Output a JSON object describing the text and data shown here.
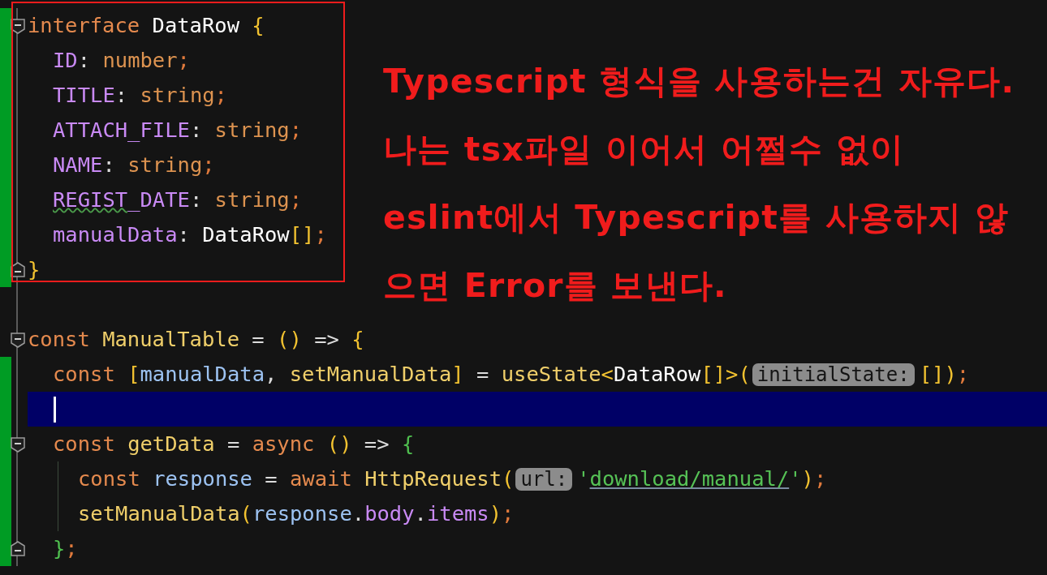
{
  "editor": {
    "lines": [
      {
        "changed": true,
        "current": false,
        "fold_end": false,
        "tokens": [
          {
            "kind": "kw",
            "text": "interface "
          },
          {
            "kind": "cls",
            "text": "DataRow "
          },
          {
            "kind": "br1",
            "text": "{"
          }
        ],
        "children": [
          {
            "changed": true,
            "current": false,
            "fold_end": false,
            "tokens": [
              {
                "kind": "prop",
                "text": "ID"
              },
              {
                "kind": "op",
                "text": ": "
              },
              {
                "kind": "type",
                "text": "number"
              },
              {
                "kind": "punct",
                "text": ";"
              }
            ]
          },
          {
            "changed": true,
            "current": false,
            "fold_end": false,
            "tokens": [
              {
                "kind": "prop",
                "text": "TITLE"
              },
              {
                "kind": "op",
                "text": ": "
              },
              {
                "kind": "type",
                "text": "string"
              },
              {
                "kind": "punct",
                "text": ";"
              }
            ]
          },
          {
            "changed": true,
            "current": false,
            "fold_end": false,
            "tokens": [
              {
                "kind": "prop",
                "text": "ATTACH_FILE"
              },
              {
                "kind": "op",
                "text": ": "
              },
              {
                "kind": "type",
                "text": "string"
              },
              {
                "kind": "punct",
                "text": ";"
              }
            ]
          },
          {
            "changed": true,
            "current": false,
            "fold_end": false,
            "tokens": [
              {
                "kind": "prop",
                "text": "NAME"
              },
              {
                "kind": "op",
                "text": ": "
              },
              {
                "kind": "type",
                "text": "string"
              },
              {
                "kind": "punct",
                "text": ";"
              }
            ]
          },
          {
            "changed": true,
            "current": false,
            "fold_end": false,
            "tokens": [
              {
                "kind": "prop",
                "text": "REGIST",
                "warning": true
              },
              {
                "kind": "prop",
                "text": "_DATE",
                "warning": false
              },
              {
                "kind": "op",
                "text": ": "
              },
              {
                "kind": "type",
                "text": "string"
              },
              {
                "kind": "punct",
                "text": ";"
              }
            ]
          },
          {
            "changed": true,
            "current": false,
            "fold_end": false,
            "tokens": [
              {
                "kind": "prop",
                "text": "manualData"
              },
              {
                "kind": "op",
                "text": ": "
              },
              {
                "kind": "cls",
                "text": "DataRow"
              },
              {
                "kind": "br1",
                "text": "[]"
              },
              {
                "kind": "punct",
                "text": ";"
              }
            ]
          }
        ]
      },
      {
        "changed": true,
        "current": false,
        "fold_end": true,
        "tokens": [
          {
            "kind": "br1",
            "text": "}"
          }
        ]
      },
      {
        "changed": false,
        "current": false,
        "fold_end": false
      },
      {
        "changed": false,
        "current": false,
        "fold_end": false,
        "tokens": [
          {
            "kind": "kw",
            "text": "const "
          },
          {
            "kind": "fn",
            "text": "ManualTable"
          },
          {
            "kind": "op",
            "text": " = "
          },
          {
            "kind": "br1",
            "text": "()"
          },
          {
            "kind": "op",
            "text": " => "
          },
          {
            "kind": "br1",
            "text": "{"
          }
        ],
        "children": [
          {
            "changed": true,
            "current": false,
            "fold_end": false,
            "tokens": [
              {
                "kind": "kw",
                "text": "const "
              },
              {
                "kind": "br1",
                "text": "["
              },
              {
                "kind": "var",
                "text": "manualData"
              },
              {
                "kind": "op",
                "text": ", "
              },
              {
                "kind": "fn",
                "text": "setManualData"
              },
              {
                "kind": "br1",
                "text": "]"
              },
              {
                "kind": "op",
                "text": " = "
              },
              {
                "kind": "fn",
                "text": "useState"
              },
              {
                "kind": "br1",
                "text": "<"
              },
              {
                "kind": "cls",
                "text": "DataRow"
              },
              {
                "kind": "br1",
                "text": "[]>("
              }
            ],
            "hint": "initialState:",
            "after": [
              {
                "kind": "br1",
                "text": "[])"
              },
              {
                "kind": "punct",
                "text": ";"
              }
            ]
          },
          {
            "changed": true,
            "current": true,
            "fold_end": false
          },
          {
            "changed": true,
            "current": false,
            "fold_end": false,
            "tokens": [
              {
                "kind": "kw",
                "text": "const "
              },
              {
                "kind": "fn",
                "text": "getData"
              },
              {
                "kind": "op",
                "text": " = "
              },
              {
                "kind": "kw",
                "text": "async "
              },
              {
                "kind": "br1",
                "text": "()"
              },
              {
                "kind": "op",
                "text": " => "
              },
              {
                "kind": "br2",
                "text": "{"
              }
            ],
            "children": [
              {
                "changed": true,
                "current": false,
                "fold_end": false,
                "tokens": [
                  {
                    "kind": "kw",
                    "text": "const "
                  },
                  {
                    "kind": "var",
                    "text": "response"
                  },
                  {
                    "kind": "op",
                    "text": " = "
                  },
                  {
                    "kind": "kw",
                    "text": "await "
                  },
                  {
                    "kind": "fn",
                    "text": "HttpRequest"
                  },
                  {
                    "kind": "br1",
                    "text": "("
                  }
                ],
                "hint": "url:",
                "after": [
                  {
                    "kind": "str",
                    "text": "'"
                  },
                  {
                    "kind": "link",
                    "text": "download/manual/"
                  },
                  {
                    "kind": "str",
                    "text": "'"
                  },
                  {
                    "kind": "br1",
                    "text": ")"
                  },
                  {
                    "kind": "punct",
                    "text": ";"
                  }
                ]
              },
              {
                "changed": true,
                "current": false,
                "fold_end": false,
                "tokens": [
                  {
                    "kind": "fn",
                    "text": "setManualData"
                  },
                  {
                    "kind": "br1",
                    "text": "("
                  },
                  {
                    "kind": "var",
                    "text": "response"
                  },
                  {
                    "kind": "op",
                    "text": "."
                  },
                  {
                    "kind": "prop",
                    "text": "body"
                  },
                  {
                    "kind": "op",
                    "text": "."
                  },
                  {
                    "kind": "prop",
                    "text": "items"
                  },
                  {
                    "kind": "br1",
                    "text": ")"
                  },
                  {
                    "kind": "punct",
                    "text": ";"
                  }
                ]
              }
            ]
          },
          {
            "changed": true,
            "current": false,
            "fold_end": true,
            "tokens": [
              {
                "kind": "br2",
                "text": "}"
              },
              {
                "kind": "punct",
                "text": ";"
              }
            ]
          }
        ]
      }
    ]
  },
  "annotation": {
    "lines": [
      "Typescript 형식을 사용하는건 자유다.",
      "나는 tsx파일 이어서 어쩔수 없이",
      "eslint에서 Typescript를 사용하지 않",
      "으면 Error를 보낸다."
    ]
  }
}
